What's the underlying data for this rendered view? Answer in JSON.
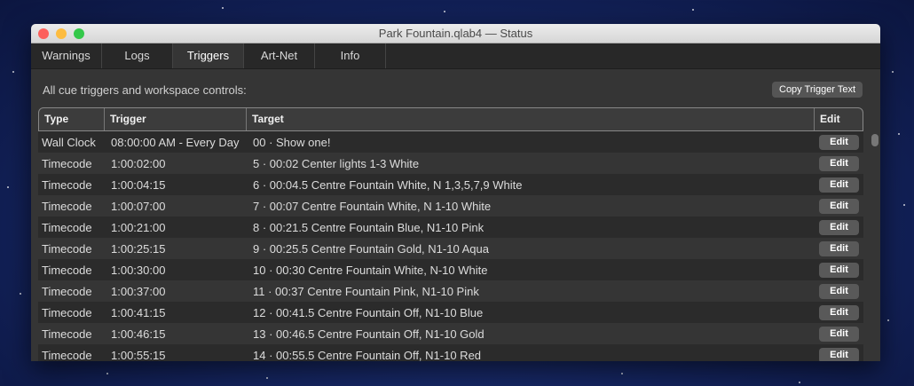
{
  "window": {
    "title": "Park Fountain.qlab4 — Status"
  },
  "tabs": [
    {
      "label": "Warnings"
    },
    {
      "label": "Logs"
    },
    {
      "label": "Triggers",
      "active": true
    },
    {
      "label": "Art-Net"
    },
    {
      "label": "Info"
    }
  ],
  "caption": "All cue triggers and workspace controls:",
  "copy_button": "Copy Trigger Text",
  "columns": [
    "Type",
    "Trigger",
    "Target",
    "Edit"
  ],
  "edit_label": "Edit",
  "rows": [
    {
      "type": "Wall Clock",
      "trigger": "08:00:00 AM - Every Day",
      "target": "00 · Show one!"
    },
    {
      "type": "Timecode",
      "trigger": "1:00:02:00",
      "target": "5 · 00:02 Center lights 1-3 White"
    },
    {
      "type": "Timecode",
      "trigger": "1:00:04:15",
      "target": "6 · 00:04.5 Centre Fountain White, N 1,3,5,7,9 White"
    },
    {
      "type": "Timecode",
      "trigger": "1:00:07:00",
      "target": "7 · 00:07 Centre Fountain White, N 1-10 White"
    },
    {
      "type": "Timecode",
      "trigger": "1:00:21:00",
      "target": "8 · 00:21.5 Centre Fountain Blue, N1-10 Pink"
    },
    {
      "type": "Timecode",
      "trigger": "1:00:25:15",
      "target": "9 · 00:25.5 Centre Fountain  Gold, N1-10 Aqua"
    },
    {
      "type": "Timecode",
      "trigger": "1:00:30:00",
      "target": "10 · 00:30 Centre Fountain White, N-10 White"
    },
    {
      "type": "Timecode",
      "trigger": "1:00:37:00",
      "target": "11 · 00:37 Centre Fountain Pink, N1-10 Pink"
    },
    {
      "type": "Timecode",
      "trigger": "1:00:41:15",
      "target": "12 · 00:41.5 Centre Fountain Off, N1-10 Blue"
    },
    {
      "type": "Timecode",
      "trigger": "1:00:46:15",
      "target": "13 · 00:46.5 Centre Fountain Off, N1-10 Gold"
    },
    {
      "type": "Timecode",
      "trigger": "1:00:55:15",
      "target": "14 · 00:55.5 Centre Fountain Off, N1-10 Red"
    }
  ]
}
